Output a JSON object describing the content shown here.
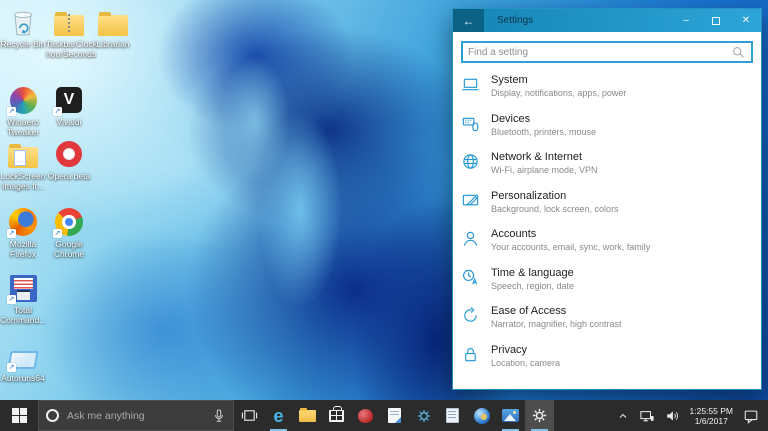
{
  "desktop": {
    "icons": [
      {
        "label": "Recycle Bin"
      },
      {
        "label": "TaskbarClock hourSeconds"
      },
      {
        "label": "Librarian"
      },
      {
        "label": "Winaero Tweaker"
      },
      {
        "label": "Vivaldi"
      },
      {
        "label": "LockScreen Images fr..."
      },
      {
        "label": "Opera beta"
      },
      {
        "label": "Mozilla Firefox"
      },
      {
        "label": "Google Chrome"
      },
      {
        "label": "Total Command..."
      },
      {
        "label": "Autoruns64"
      }
    ]
  },
  "settings_window": {
    "title": "Settings",
    "back_glyph": "←",
    "window_controls": {
      "minimize": "–",
      "close": "✕"
    },
    "search_placeholder": "Find a setting",
    "accent_color": "#2196d4",
    "titlebar_color": "#1e95c8",
    "categories": [
      {
        "title": "System",
        "subtitle": "Display, notifications, apps, power"
      },
      {
        "title": "Devices",
        "subtitle": "Bluetooth, printers, mouse"
      },
      {
        "title": "Network & Internet",
        "subtitle": "Wi-Fi, airplane mode, VPN"
      },
      {
        "title": "Personalization",
        "subtitle": "Background, lock screen, colors"
      },
      {
        "title": "Accounts",
        "subtitle": "Your accounts, email, sync, work, family"
      },
      {
        "title": "Time & language",
        "subtitle": "Speech, region, date"
      },
      {
        "title": "Ease of Access",
        "subtitle": "Narrator, magnifier, high contrast"
      },
      {
        "title": "Privacy",
        "subtitle": "Location, camera"
      }
    ]
  },
  "taskbar": {
    "search_placeholder": "Ask me anything",
    "apps": [
      {
        "name": "microsoft-edge",
        "running": true
      },
      {
        "name": "file-explorer",
        "running": false
      },
      {
        "name": "windows-store",
        "running": false
      },
      {
        "name": "red-app",
        "running": false
      },
      {
        "name": "document-app",
        "running": false
      },
      {
        "name": "blue-gear-app",
        "running": false
      },
      {
        "name": "notepad-app",
        "running": false
      },
      {
        "name": "earth-app",
        "running": false
      },
      {
        "name": "imaging-app",
        "running": true
      },
      {
        "name": "settings",
        "running": true,
        "active": true
      }
    ],
    "tray": {
      "time": "1:25:55 PM",
      "date": "1/6/2017"
    }
  }
}
